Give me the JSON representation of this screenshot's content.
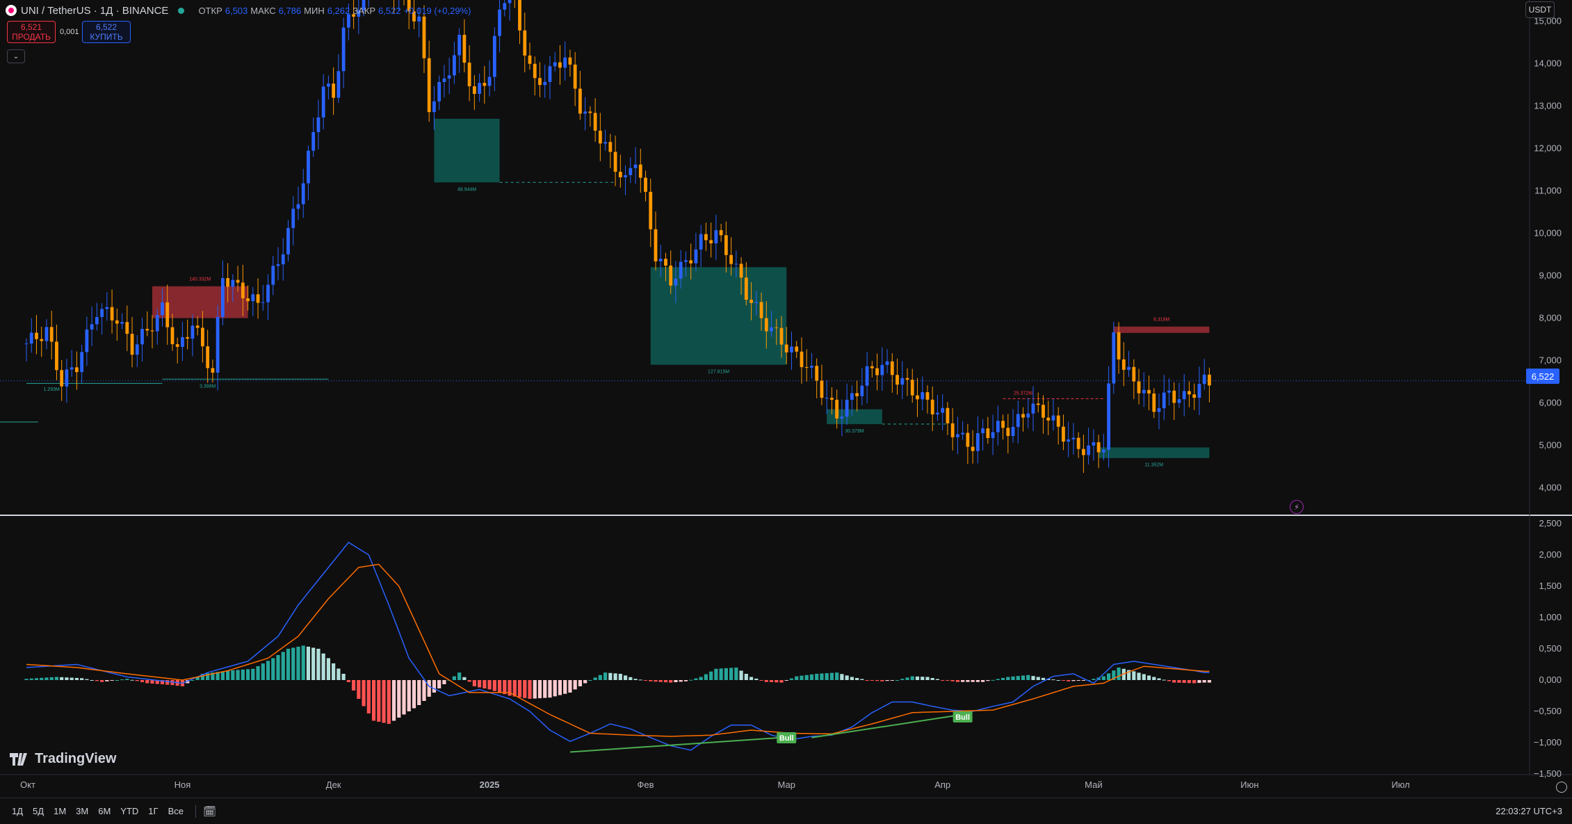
{
  "legend": {
    "symbol_title": "UNI / TetherUS · 1Д · BINANCE",
    "ohlc": [
      {
        "k": "ОТКР",
        "v": "6,503"
      },
      {
        "k": "МАКС",
        "v": "6,786"
      },
      {
        "k": "МИН",
        "v": "6,262"
      },
      {
        "k": "ЗАКР",
        "v": "6,522"
      },
      {
        "k": "",
        "v": "+0,019 (+0,29%)"
      }
    ]
  },
  "trade": {
    "sell_price": "6,521",
    "sell_label": "ПРОДАТЬ",
    "spread": "0,001",
    "buy_price": "6,522",
    "buy_label": "КУПИТЬ"
  },
  "currency": "USDT",
  "last_price": "6,522",
  "price_axis": [
    {
      "label": "15,000",
      "v": 15000
    },
    {
      "label": "14,000",
      "v": 14000
    },
    {
      "label": "13,000",
      "v": 13000
    },
    {
      "label": "12,000",
      "v": 12000
    },
    {
      "label": "11,000",
      "v": 11000
    },
    {
      "label": "10,000",
      "v": 10000
    },
    {
      "label": "9,000",
      "v": 9000
    },
    {
      "label": "8,000",
      "v": 8000
    },
    {
      "label": "7,000",
      "v": 7000
    },
    {
      "label": "6,000",
      "v": 6000
    },
    {
      "label": "5,000",
      "v": 5000
    },
    {
      "label": "4,000",
      "v": 4000
    }
  ],
  "macd_axis": [
    {
      "label": "2,500",
      "v": 2.5
    },
    {
      "label": "2,000",
      "v": 2.0
    },
    {
      "label": "1,500",
      "v": 1.5
    },
    {
      "label": "1,000",
      "v": 1.0
    },
    {
      "label": "0,500",
      "v": 0.5
    },
    {
      "label": "0,000",
      "v": 0
    },
    {
      "label": "−0,500",
      "v": -0.5
    },
    {
      "label": "−1,000",
      "v": -1.0
    },
    {
      "label": "−1,500",
      "v": -1.5
    }
  ],
  "time_axis": [
    {
      "label": "Окт",
      "i": 0
    },
    {
      "label": "Ноя",
      "i": 31
    },
    {
      "label": "Дек",
      "i": 61
    },
    {
      "label": "2025",
      "i": 92,
      "bold": true
    },
    {
      "label": "Фев",
      "i": 123
    },
    {
      "label": "Мар",
      "i": 151
    },
    {
      "label": "Апр",
      "i": 182
    },
    {
      "label": "Май",
      "i": 212
    },
    {
      "label": "Июн",
      "i": 243
    },
    {
      "label": "Июл",
      "i": 273
    }
  ],
  "zones": [
    {
      "label": "140.332M",
      "i0": 25,
      "i1": 44,
      "lo": 8000,
      "hi": 8750,
      "kind": "bear"
    },
    {
      "label": "48.944M",
      "i0": 81,
      "i1": 94,
      "lo": 11200,
      "hi": 12700,
      "kind": "bull",
      "line": "dashed",
      "line_to": 117
    },
    {
      "label": "127.915M",
      "i0": 124,
      "i1": 151,
      "lo": 6900,
      "hi": 9200,
      "kind": "bull"
    },
    {
      "label": "30.379M",
      "i0": 159,
      "i1": 170,
      "lo": 5500,
      "hi": 5850,
      "kind": "bull",
      "line": "dashed",
      "line_to": 183
    },
    {
      "label": "8.319M",
      "i0": 216,
      "i1": 235,
      "lo": 7650,
      "hi": 7800,
      "kind": "bear"
    },
    {
      "label": "11.352M",
      "i0": 213,
      "i1": 235,
      "lo": 4700,
      "hi": 4950,
      "kind": "bull"
    }
  ],
  "level_labels": [
    {
      "label": "1.293M",
      "i": 5,
      "p": 6480
    },
    {
      "label": "3.398M",
      "i": 36,
      "p": 6560
    },
    {
      "label": "25.372M",
      "i": 198,
      "p": 6100
    }
  ],
  "signals": [
    {
      "label": "Bull",
      "i": 151
    },
    {
      "label": "Bull",
      "i": 186
    }
  ],
  "chart_data": {
    "type": "candlestick",
    "symbol": "UNI / TetherUS",
    "timeframe": "1Д",
    "exchange": "BINANCE",
    "ylim": [
      3400,
      15500
    ],
    "close_path": [
      [
        0,
        7.4
      ],
      [
        4,
        7.7
      ],
      [
        7,
        6.5
      ],
      [
        10,
        6.9
      ],
      [
        14,
        8.2
      ],
      [
        18,
        8.0
      ],
      [
        21,
        7.3
      ],
      [
        24,
        7.7
      ],
      [
        27,
        8.2
      ],
      [
        30,
        7.2
      ],
      [
        33,
        7.9
      ],
      [
        37,
        6.7
      ],
      [
        39,
        9.0
      ],
      [
        42,
        8.7
      ],
      [
        46,
        8.3
      ],
      [
        50,
        9.3
      ],
      [
        54,
        10.8
      ],
      [
        57,
        12.3
      ],
      [
        59,
        13.5
      ],
      [
        61,
        13.2
      ],
      [
        63,
        14.8
      ],
      [
        66,
        15.4
      ],
      [
        70,
        16.2
      ],
      [
        74,
        15.6
      ],
      [
        78,
        15.0
      ],
      [
        80,
        13.0
      ],
      [
        83,
        13.6
      ],
      [
        86,
        14.5
      ],
      [
        89,
        13.2
      ],
      [
        92,
        13.8
      ],
      [
        94,
        15.2
      ],
      [
        96,
        16.0
      ],
      [
        98,
        14.8
      ],
      [
        101,
        13.5
      ],
      [
        104,
        13.8
      ],
      [
        107,
        14.2
      ],
      [
        110,
        13.0
      ],
      [
        113,
        12.5
      ],
      [
        116,
        11.8
      ],
      [
        119,
        11.2
      ],
      [
        121,
        11.8
      ],
      [
        123,
        10.8
      ],
      [
        125,
        9.5
      ],
      [
        128,
        8.9
      ],
      [
        131,
        9.3
      ],
      [
        134,
        9.8
      ],
      [
        137,
        10.0
      ],
      [
        140,
        9.4
      ],
      [
        143,
        8.6
      ],
      [
        146,
        8.0
      ],
      [
        149,
        7.6
      ],
      [
        152,
        7.2
      ],
      [
        155,
        6.9
      ],
      [
        158,
        6.3
      ],
      [
        161,
        5.7
      ],
      [
        164,
        6.1
      ],
      [
        167,
        6.7
      ],
      [
        170,
        6.9
      ],
      [
        173,
        6.6
      ],
      [
        176,
        6.3
      ],
      [
        179,
        6.0
      ],
      [
        182,
        5.7
      ],
      [
        185,
        5.2
      ],
      [
        188,
        5.0
      ],
      [
        190,
        5.3
      ],
      [
        193,
        5.4
      ],
      [
        196,
        5.4
      ],
      [
        199,
        5.9
      ],
      [
        202,
        5.8
      ],
      [
        205,
        5.4
      ],
      [
        208,
        5.0
      ],
      [
        211,
        4.9
      ],
      [
        214,
        5.0
      ],
      [
        216,
        7.6
      ],
      [
        218,
        6.8
      ],
      [
        221,
        6.4
      ],
      [
        224,
        5.9
      ],
      [
        227,
        6.2
      ],
      [
        230,
        6.1
      ],
      [
        232,
        6.3
      ],
      [
        234,
        6.5
      ]
    ],
    "hist_path": [
      [
        0,
        0.02
      ],
      [
        6,
        0.05
      ],
      [
        11,
        0.03
      ],
      [
        15,
        -0.03
      ],
      [
        20,
        0.02
      ],
      [
        24,
        -0.05
      ],
      [
        29,
        -0.08
      ],
      [
        31,
        -0.1
      ],
      [
        35,
        0.1
      ],
      [
        40,
        0.15
      ],
      [
        45,
        0.18
      ],
      [
        49,
        0.35
      ],
      [
        52,
        0.5
      ],
      [
        55,
        0.55
      ],
      [
        58,
        0.5
      ],
      [
        60,
        0.35
      ],
      [
        63,
        0.1
      ],
      [
        66,
        -0.3
      ],
      [
        69,
        -0.65
      ],
      [
        72,
        -0.7
      ],
      [
        75,
        -0.55
      ],
      [
        78,
        -0.4
      ],
      [
        81,
        -0.2
      ],
      [
        84,
        0.0
      ],
      [
        86,
        0.12
      ],
      [
        89,
        -0.1
      ],
      [
        92,
        -0.15
      ],
      [
        96,
        -0.25
      ],
      [
        100,
        -0.3
      ],
      [
        104,
        -0.28
      ],
      [
        108,
        -0.2
      ],
      [
        112,
        0.0
      ],
      [
        115,
        0.12
      ],
      [
        118,
        0.1
      ],
      [
        121,
        0.02
      ],
      [
        124,
        -0.02
      ],
      [
        128,
        -0.04
      ],
      [
        131,
        -0.02
      ],
      [
        134,
        0.05
      ],
      [
        137,
        0.18
      ],
      [
        141,
        0.2
      ],
      [
        144,
        0.05
      ],
      [
        147,
        -0.03
      ],
      [
        150,
        -0.04
      ],
      [
        153,
        0.06
      ],
      [
        157,
        0.1
      ],
      [
        161,
        0.12
      ],
      [
        164,
        0.05
      ],
      [
        167,
        0.0
      ],
      [
        170,
        -0.02
      ],
      [
        173,
        0.0
      ],
      [
        176,
        0.06
      ],
      [
        179,
        0.05
      ],
      [
        182,
        0.0
      ],
      [
        185,
        -0.03
      ],
      [
        190,
        -0.03
      ],
      [
        195,
        0.05
      ],
      [
        199,
        0.08
      ],
      [
        203,
        0.02
      ],
      [
        207,
        -0.02
      ],
      [
        211,
        0.0
      ],
      [
        214,
        0.06
      ],
      [
        217,
        0.2
      ],
      [
        220,
        0.14
      ],
      [
        224,
        0.05
      ],
      [
        228,
        -0.04
      ],
      [
        232,
        -0.05
      ],
      [
        234,
        -0.04
      ]
    ],
    "macd_line_path": [
      [
        0,
        0.2
      ],
      [
        10,
        0.25
      ],
      [
        20,
        0.05
      ],
      [
        31,
        -0.05
      ],
      [
        36,
        0.12
      ],
      [
        44,
        0.3
      ],
      [
        50,
        0.7
      ],
      [
        54,
        1.2
      ],
      [
        58,
        1.6
      ],
      [
        61,
        1.9
      ],
      [
        64,
        2.2
      ],
      [
        68,
        2.0
      ],
      [
        72,
        1.2
      ],
      [
        76,
        0.35
      ],
      [
        80,
        -0.1
      ],
      [
        84,
        -0.25
      ],
      [
        90,
        -0.15
      ],
      [
        96,
        -0.3
      ],
      [
        100,
        -0.5
      ],
      [
        104,
        -0.8
      ],
      [
        108,
        -0.98
      ],
      [
        112,
        -0.85
      ],
      [
        116,
        -0.7
      ],
      [
        120,
        -0.78
      ],
      [
        124,
        -0.92
      ],
      [
        128,
        -1.05
      ],
      [
        132,
        -1.12
      ],
      [
        136,
        -0.9
      ],
      [
        140,
        -0.72
      ],
      [
        144,
        -0.72
      ],
      [
        148,
        -0.88
      ],
      [
        152,
        -0.95
      ],
      [
        156,
        -0.9
      ],
      [
        160,
        -0.88
      ],
      [
        164,
        -0.75
      ],
      [
        168,
        -0.52
      ],
      [
        172,
        -0.35
      ],
      [
        176,
        -0.35
      ],
      [
        180,
        -0.42
      ],
      [
        184,
        -0.48
      ],
      [
        188,
        -0.5
      ],
      [
        192,
        -0.42
      ],
      [
        196,
        -0.35
      ],
      [
        200,
        -0.1
      ],
      [
        204,
        0.06
      ],
      [
        208,
        0.1
      ],
      [
        212,
        -0.05
      ],
      [
        216,
        0.25
      ],
      [
        220,
        0.3
      ],
      [
        224,
        0.25
      ],
      [
        228,
        0.2
      ],
      [
        232,
        0.15
      ],
      [
        234,
        0.12
      ]
    ],
    "signal_line_path": [
      [
        0,
        0.25
      ],
      [
        10,
        0.2
      ],
      [
        20,
        0.1
      ],
      [
        31,
        0.0
      ],
      [
        40,
        0.15
      ],
      [
        48,
        0.35
      ],
      [
        54,
        0.7
      ],
      [
        60,
        1.3
      ],
      [
        66,
        1.8
      ],
      [
        70,
        1.85
      ],
      [
        74,
        1.5
      ],
      [
        78,
        0.8
      ],
      [
        82,
        0.1
      ],
      [
        88,
        -0.2
      ],
      [
        96,
        -0.2
      ],
      [
        104,
        -0.55
      ],
      [
        112,
        -0.85
      ],
      [
        120,
        -0.88
      ],
      [
        128,
        -0.9
      ],
      [
        136,
        -0.88
      ],
      [
        144,
        -0.8
      ],
      [
        152,
        -0.85
      ],
      [
        160,
        -0.86
      ],
      [
        168,
        -0.7
      ],
      [
        176,
        -0.52
      ],
      [
        184,
        -0.5
      ],
      [
        192,
        -0.48
      ],
      [
        200,
        -0.3
      ],
      [
        208,
        -0.1
      ],
      [
        214,
        -0.05
      ],
      [
        218,
        0.1
      ],
      [
        222,
        0.22
      ],
      [
        228,
        0.18
      ],
      [
        234,
        0.14
      ]
    ],
    "divergence_lines": [
      [
        [
          108,
          -1.15
        ],
        [
          150,
          -0.92
        ]
      ],
      [
        [
          156,
          -0.92
        ],
        [
          186,
          -0.55
        ]
      ]
    ]
  },
  "bottom": {
    "timeframes": [
      "1Д",
      "5Д",
      "1М",
      "3М",
      "6М",
      "YTD",
      "1Г",
      "Все"
    ],
    "clock": "22:03:27 UTC+3"
  },
  "brand": "TradingView",
  "colors": {
    "bull": "#2962ff",
    "bear": "#ff9800",
    "macd_line": "#2962ff",
    "signal_line": "#ff6d00",
    "hist_pos_strong": "#26a69a",
    "hist_pos_weak": "#b2dfdb",
    "hist_neg_strong": "#ff5252",
    "hist_neg_weak": "#ffcdd2",
    "zone_bull": "#0e5c53",
    "zone_bear": "#9b2d32",
    "divergence": "#4caf50"
  }
}
